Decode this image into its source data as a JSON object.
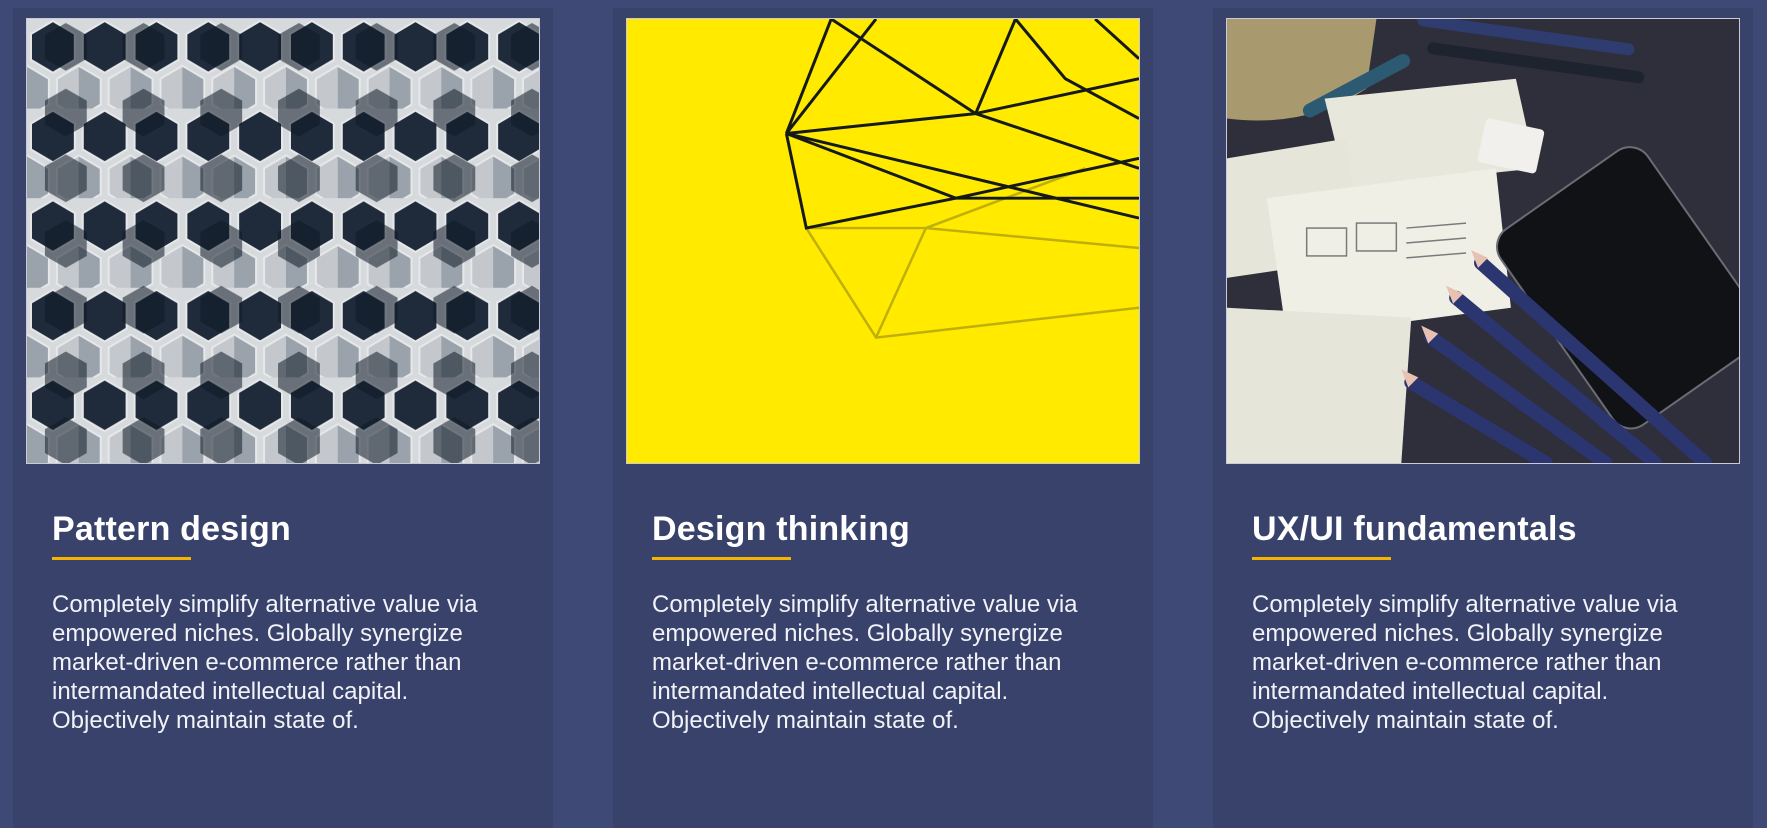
{
  "cards": [
    {
      "title": "Pattern design",
      "description": "Completely simplify alternative value via empowered niches. Globally synergize market-driven e-commerce rather than intermandated intellectual capital. Objectively maintain state of.",
      "image": "hexagon-pattern-image"
    },
    {
      "title": "Design thinking",
      "description": "Completely simplify alternative value via empowered niches. Globally synergize market-driven e-commerce rather than intermandated intellectual capital. Objectively maintain state of.",
      "image": "wire-geometric-shape-image"
    },
    {
      "title": "UX/UI fundamentals",
      "description": "Completely simplify alternative value via empowered niches. Globally synergize market-driven e-commerce rather than intermandated intellectual capital. Objectively maintain state of.",
      "image": "wireframe-sketches-desk-image"
    }
  ],
  "colors": {
    "page_background": "#3e4975",
    "card_background": "#38426a",
    "accent": "#f5b400",
    "text": "#ffffff"
  }
}
